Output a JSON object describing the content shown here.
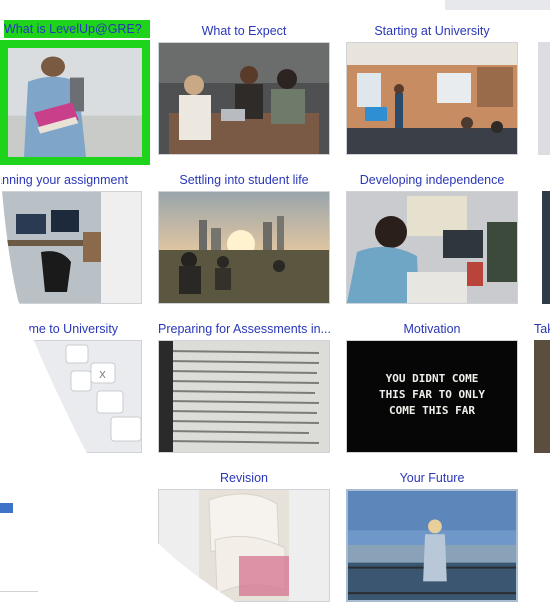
{
  "topics": [
    {
      "title": "What is LevelUp@GRE?",
      "selected": true,
      "image": "student-with-books"
    },
    {
      "title": "What to Expect",
      "image": "students-at-table"
    },
    {
      "title": "Starting at University",
      "image": "lecture-room"
    },
    {
      "title": "Planning your assignment",
      "image": "study-desk"
    },
    {
      "title": "Settling into student life",
      "image": "city-sunset"
    },
    {
      "title": "Developing independence",
      "image": "student-writing"
    },
    {
      "title": "Welcome to University",
      "image": "keyboard-closeup"
    },
    {
      "title": "Preparing for Assessments in...",
      "image": "printed-text"
    },
    {
      "title": "Motivation",
      "image": "motivation-sign",
      "sign_text": "YOU DIDNT COME THIS FAR TO ONLY COME THIS FAR"
    },
    {
      "title": "Revision",
      "image": "stacked-notebooks"
    },
    {
      "title": "Your Future",
      "image": "person-at-waterfront"
    }
  ],
  "partial_titles": {
    "row3_right": "Tak"
  },
  "colors": {
    "title": "#2a37b8",
    "selected_border": "#1ed41a",
    "accent": "#3f73c8"
  }
}
